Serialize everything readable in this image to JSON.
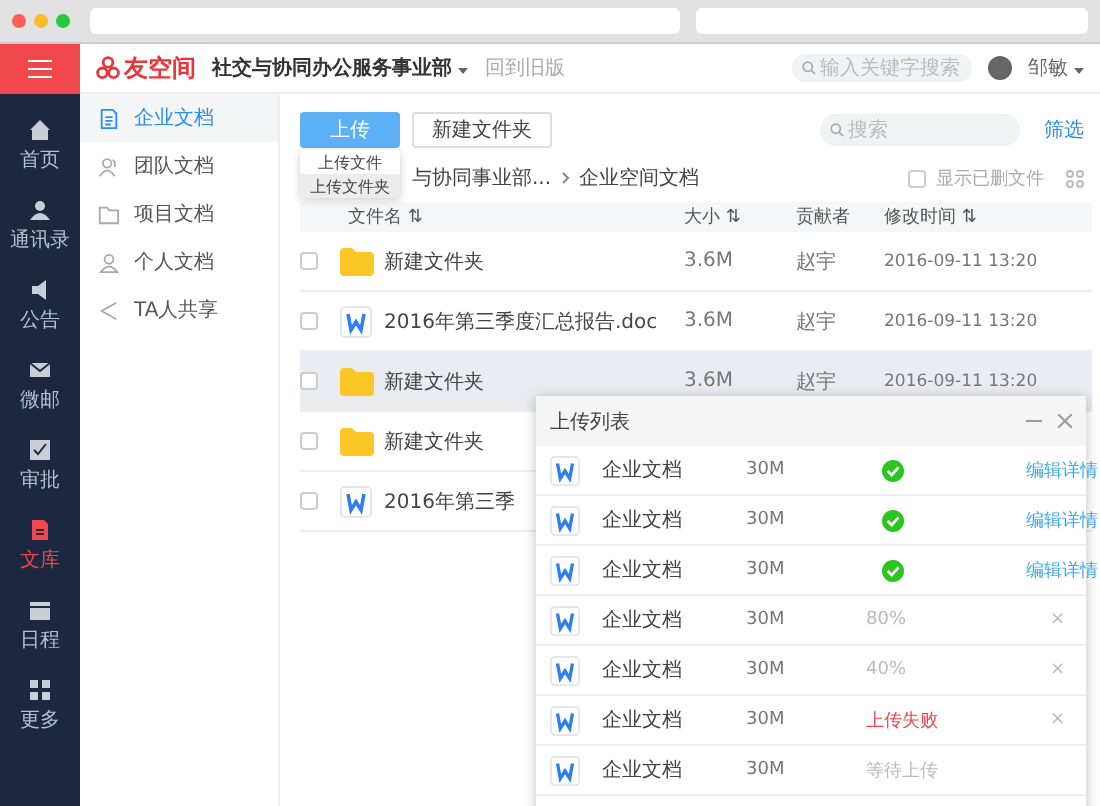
{
  "header": {
    "logo": "友空间",
    "org": "社交与协同办公服务事业部",
    "back_link": "回到旧版",
    "search": {
      "placeholder": "输入关键字搜索"
    },
    "user": "邹敏"
  },
  "nav": [
    {
      "label": "首页",
      "selected": false
    },
    {
      "label": "通讯录",
      "selected": false
    },
    {
      "label": "公告",
      "selected": false
    },
    {
      "label": "微邮",
      "selected": false
    },
    {
      "label": "审批",
      "selected": false
    },
    {
      "label": "文库",
      "selected": true
    },
    {
      "label": "日程",
      "selected": false
    },
    {
      "label": "更多",
      "selected": false
    }
  ],
  "sidebar": [
    {
      "label": "企业文档",
      "selected": true
    },
    {
      "label": "团队文档",
      "selected": false
    },
    {
      "label": "项目文档",
      "selected": false
    },
    {
      "label": "个人文档",
      "selected": false
    },
    {
      "label": "TA人共享",
      "selected": false
    }
  ],
  "toolbar": {
    "upload": "上传",
    "new_folder": "新建文件夹",
    "search": {
      "placeholder": "搜索"
    },
    "filter": "筛选"
  },
  "upload_menu": [
    {
      "label": "上传文件",
      "selected": false
    },
    {
      "label": "上传文件夹",
      "selected": true
    }
  ],
  "breadcrumb": [
    "与协同事业部...",
    "企业空间文档"
  ],
  "show_deleted": {
    "label": "显示已删文件",
    "checked": false
  },
  "table": {
    "columns": [
      "文件名 ⇅",
      "大小 ⇅",
      "贡献者",
      "修改时间 ⇅"
    ],
    "rows": [
      {
        "kind": "folder",
        "checked": false,
        "selected": false,
        "name": "新建文件夹",
        "size": "3.6M",
        "contributor": "赵宇",
        "time": "2016-09-11 13:20"
      },
      {
        "kind": "doc",
        "checked": false,
        "selected": false,
        "name": "2016年第三季度汇总报告.doc",
        "size": "3.6M",
        "contributor": "赵宇",
        "time": "2016-09-11 13:20"
      },
      {
        "kind": "folder",
        "checked": false,
        "selected": true,
        "name": "新建文件夹",
        "size": "3.6M",
        "contributor": "赵宇",
        "time": "2016-09-11 13:20"
      },
      {
        "kind": "folder",
        "checked": false,
        "selected": false,
        "name": "新建文件夹"
      },
      {
        "kind": "doc",
        "checked": false,
        "selected": false,
        "name": "2016年第三季"
      }
    ]
  },
  "upload_panel": {
    "title": "上传列表",
    "rows": [
      {
        "name": "企业文档",
        "size": "30M",
        "kind": "done",
        "action": "编辑详情"
      },
      {
        "name": "企业文档",
        "size": "30M",
        "kind": "done",
        "action": "编辑详情"
      },
      {
        "name": "企业文档",
        "size": "30M",
        "kind": "done",
        "action": "编辑详情"
      },
      {
        "name": "企业文档",
        "size": "30M",
        "kind": "progress",
        "status_text": "80%",
        "action": "×"
      },
      {
        "name": "企业文档",
        "size": "30M",
        "kind": "progress",
        "status_text": "40%",
        "action": "×"
      },
      {
        "name": "企业文档",
        "size": "30M",
        "kind": "failed",
        "status_text": "上传失败",
        "action": "×"
      },
      {
        "name": "企业文档",
        "size": "30M",
        "kind": "waiting",
        "status_text": "等待上传"
      }
    ]
  }
}
